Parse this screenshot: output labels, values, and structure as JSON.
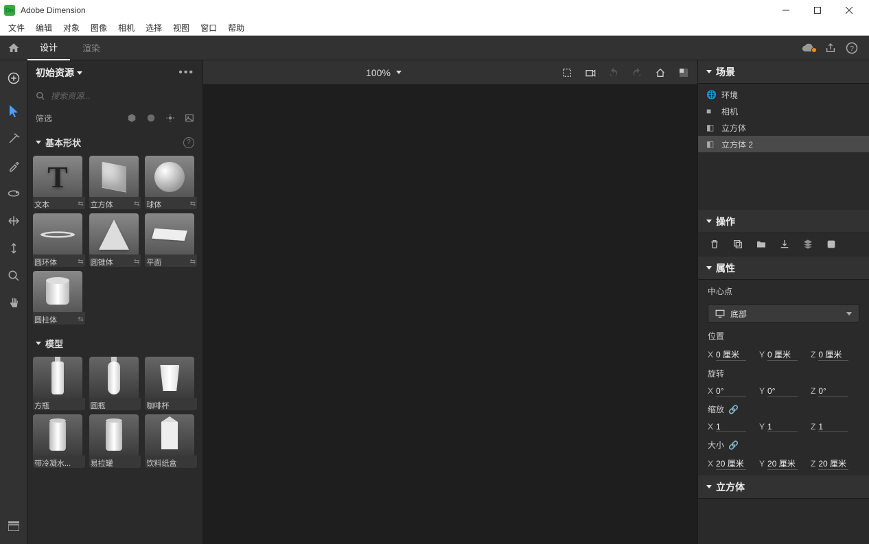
{
  "app": {
    "title": "Adobe Dimension",
    "icon_label": "Dn"
  },
  "menu": [
    "文件",
    "编辑",
    "对象",
    "图像",
    "相机",
    "选择",
    "视图",
    "窗口",
    "帮助"
  ],
  "tabs": {
    "design": "设计",
    "render": "渲染"
  },
  "zoom": "100%",
  "assets_panel": {
    "title": "初始资源",
    "search_placeholder": "搜索资源...",
    "filter_label": "筛选",
    "sections": {
      "shapes": {
        "title": "基本形状",
        "items": [
          "文本",
          "立方体",
          "球体",
          "圆环体",
          "圆锥体",
          "平面",
          "圆柱体"
        ]
      },
      "models": {
        "title": "模型",
        "items": [
          "方瓶",
          "圆瓶",
          "咖啡杯",
          "带冷凝水...",
          "易拉罐",
          "饮料纸盒"
        ]
      }
    }
  },
  "scene_panel": {
    "title": "场景",
    "items": [
      {
        "label": "环境",
        "icon": "globe"
      },
      {
        "label": "相机",
        "icon": "camera"
      },
      {
        "label": "立方体",
        "icon": "cube"
      },
      {
        "label": "立方体 2",
        "icon": "cube",
        "selected": true
      }
    ]
  },
  "actions_panel": {
    "title": "操作"
  },
  "properties_panel": {
    "title": "属性",
    "pivot_label": "中心点",
    "pivot_value": "底部",
    "groups": {
      "position": {
        "label": "位置",
        "x": "0 厘米",
        "y": "0 厘米",
        "z": "0 厘米"
      },
      "rotation": {
        "label": "旋转",
        "x": "0°",
        "y": "0°",
        "z": "0°"
      },
      "scale": {
        "label": "缩放",
        "x": "1",
        "y": "1",
        "z": "1"
      },
      "size": {
        "label": "大小",
        "x": "20 厘米",
        "y": "20 厘米",
        "z": "20 厘米"
      }
    }
  },
  "object_panel": {
    "title": "立方体"
  }
}
